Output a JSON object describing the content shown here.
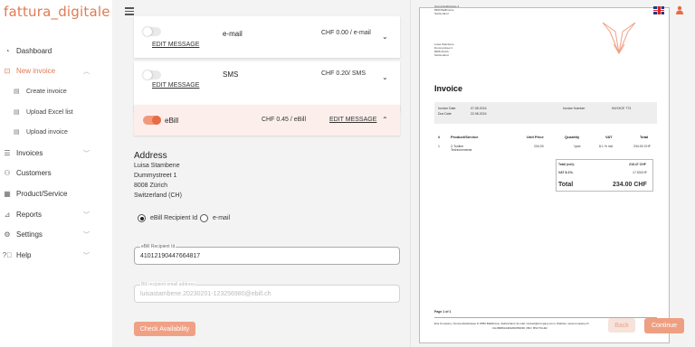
{
  "app": {
    "logo": "fattura_digitale"
  },
  "sidebar": {
    "items": [
      {
        "label": "Dashboard",
        "icon": "dashboard-icon"
      },
      {
        "label": "New invoice",
        "icon": "new-invoice-icon",
        "active": true
      },
      {
        "label": "Invoices",
        "icon": "list-icon"
      },
      {
        "label": "Customers",
        "icon": "users-icon"
      },
      {
        "label": "Product/Service",
        "icon": "product-icon"
      },
      {
        "label": "Reports",
        "icon": "reports-icon"
      },
      {
        "label": "Settings",
        "icon": "gear-icon"
      },
      {
        "label": "Help",
        "icon": "help-icon"
      }
    ],
    "sub_items": [
      {
        "label": "Create invoice",
        "icon": "document-icon"
      },
      {
        "label": "Upload Excel list",
        "icon": "document-icon"
      },
      {
        "label": "Upload invoice",
        "icon": "document-icon"
      }
    ]
  },
  "channels": [
    {
      "name": "e-mail",
      "price": "CHF 0.00 / e-mail",
      "edit": "EDIT MESSAGE",
      "enabled": false
    },
    {
      "name": "SMS",
      "price": "CHF 0.20/ SMS",
      "edit": "EDIT MESSAGE",
      "enabled": false
    },
    {
      "name": "eBill",
      "price": "CHF 0.45 / eBill",
      "edit": "EDIT MESSAGE",
      "enabled": true
    }
  ],
  "address": {
    "title": "Address",
    "lines": [
      "Luisa Stambene",
      "Dummystreet 1",
      "8008 Zürich",
      "Switzerland (CH)"
    ]
  },
  "recipient_options": {
    "option1": "eBill Recipient Id",
    "option2": "e-mail"
  },
  "ebill_field": {
    "label": "eBill Recipient Id",
    "value": "41012190447664817"
  },
  "email_field": {
    "label": "Bill recipient email address",
    "value": "luisastambene.20230201-123256980@ebill.ch"
  },
  "buttons": {
    "check": "Check Availability",
    "back": "Back",
    "continue": "Continue"
  },
  "preview": {
    "sender_lines": [
      "Sonnenfeldstrasse 4",
      "8950 Ballbinorie",
      "Switzerland"
    ],
    "recipient_lines": [
      "Luisa Stambene",
      "Dummystreet 1",
      "8008 Zürich",
      "Switzerland"
    ],
    "title": "Invoice",
    "meta": {
      "invoice_date_label": "Invoice Date",
      "invoice_date": "07.08.2024",
      "due_date_label": "Due Date",
      "due_date": "22.08.2024",
      "invoice_number_label": "Invoice Number",
      "invoice_number": "INVOICE 773"
    },
    "table": {
      "headers": [
        "#",
        "Product/Service",
        "Unit Price",
        "Quantity",
        "VAT",
        "Total"
      ],
      "rows": [
        [
          "1",
          "2-Tooline\nTechnicements",
          "234.00",
          "1pce",
          "8.1 % incl",
          "234.00 CHF"
        ]
      ]
    },
    "totals": [
      {
        "label": "Total (net):",
        "value": "216.47 CHF"
      },
      {
        "label": "VAT 8.1%:",
        "value": "17.53CHF"
      },
      {
        "label": "Total",
        "value": "234.00 CHF"
      }
    ],
    "page": "Page 1 of 1",
    "footer1": "Eva Company | Sonnenfeldstrasse 8, 8950 Ballbizona, Switzerland | E-mail: contact@company.com | Website: www.company.ch",
    "footer2": "CH1898914400200050030 | BIC: BSCTCH22"
  },
  "colors": {
    "accent": "#e07a55",
    "button": "#ee9f82"
  }
}
